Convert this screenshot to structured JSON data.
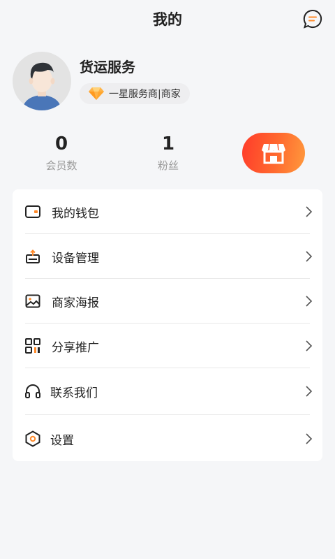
{
  "header": {
    "title": "我的"
  },
  "profile": {
    "name": "货运服务",
    "badge": "一星服务商|商家"
  },
  "stats": [
    {
      "value": "0",
      "label": "会员数"
    },
    {
      "value": "1",
      "label": "粉丝"
    }
  ],
  "menu": [
    {
      "label": "我的钱包",
      "icon": "wallet-icon"
    },
    {
      "label": "设备管理",
      "icon": "device-icon"
    },
    {
      "label": "商家海报",
      "icon": "poster-image-icon"
    },
    {
      "label": "分享推广",
      "icon": "qr-code-icon"
    },
    {
      "label": "联系我们",
      "icon": "headset-icon"
    },
    {
      "label": "设置",
      "icon": "settings-hexagon-icon"
    }
  ],
  "colors": {
    "accent_start": "#ff3b2a",
    "accent_end": "#ff9a3d",
    "badge_bg": "#eeeef0",
    "background": "#f5f6f8"
  }
}
